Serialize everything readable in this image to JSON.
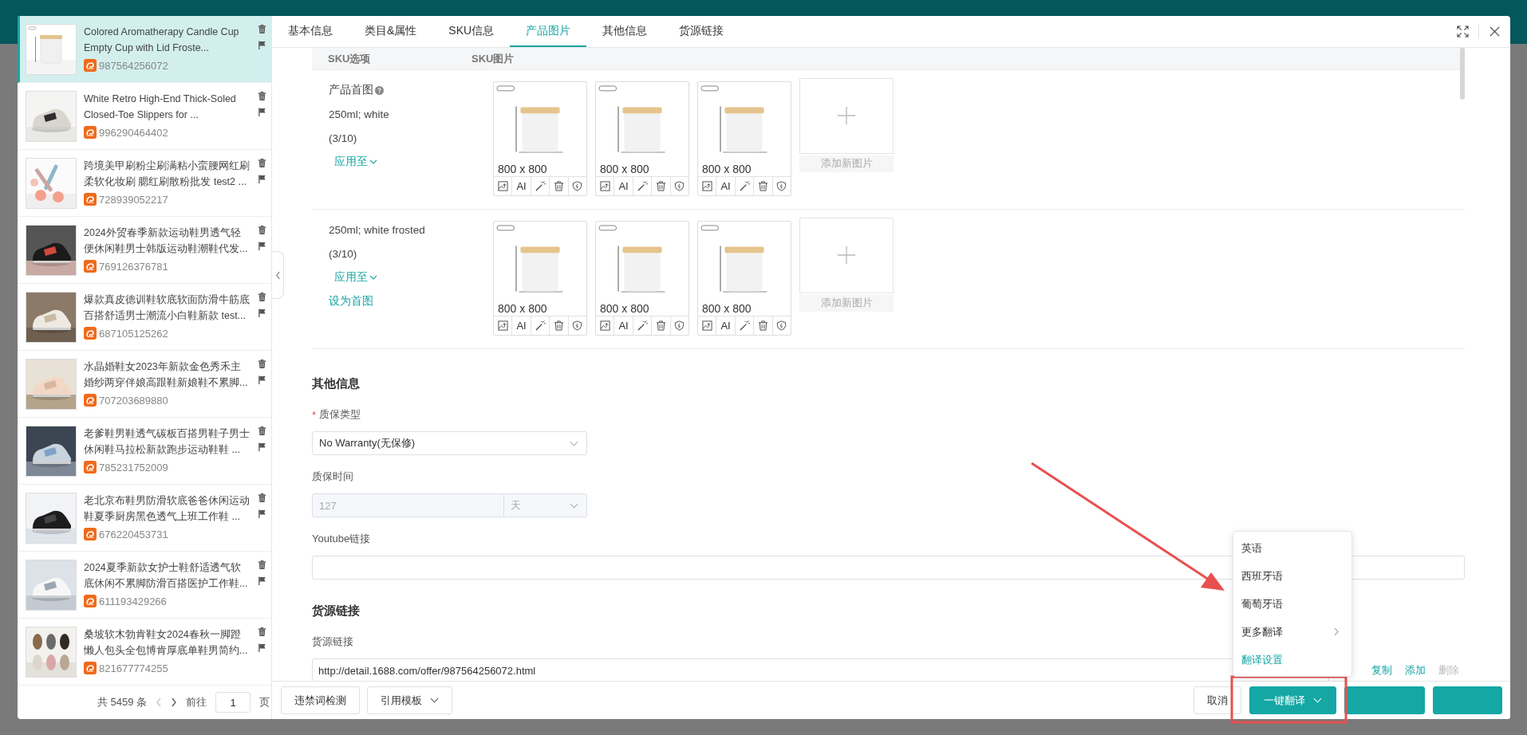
{
  "products": [
    {
      "title": "Colored Aromatherapy Candle Cup Empty Cup with Lid Froste...",
      "id": "987564256072",
      "selected": true
    },
    {
      "title": "White Retro High-End Thick-Soled Closed-Toe Slippers for ...",
      "id": "996290464402",
      "selected": false
    },
    {
      "title": "跨境美甲刷粉尘刷满粘小蛮腰网红刷柔软化妆刷 腮红刷散粉批发 test2 ...",
      "id": "728939052217",
      "selected": false
    },
    {
      "title": "2024外贸春季新款运动鞋男透气轻便休闲鞋男士韩版运动鞋潮鞋代发...",
      "id": "769126376781",
      "selected": false
    },
    {
      "title": "爆款真皮德训鞋软底软面防滑牛筋底百搭舒适男士潮流小白鞋新款 test...",
      "id": "687105125262",
      "selected": false
    },
    {
      "title": "水晶婚鞋女2023年新款金色秀禾主婚纱两穿伴娘高跟鞋新娘鞋不累脚...",
      "id": "707203689880",
      "selected": false
    },
    {
      "title": "老爹鞋男鞋透气碳板百搭男鞋子男士休闲鞋马拉松新款跑步运动鞋鞋 ...",
      "id": "785231752009",
      "selected": false
    },
    {
      "title": "老北京布鞋男防滑软底爸爸休闲运动鞋夏季厨房黑色透气上班工作鞋 ...",
      "id": "676220453731",
      "selected": false
    },
    {
      "title": "2024夏季新款女护士鞋舒适透气软底休闲不累脚防滑百搭医护工作鞋...",
      "id": "611193429266",
      "selected": false
    },
    {
      "title": "桑坡软木勃肯鞋女2024春秋一脚蹬懒人包头全包博肯厚底单鞋男简约...",
      "id": "821677774255",
      "selected": false
    }
  ],
  "pagination": {
    "total": "共 5459 条",
    "goto": "前往",
    "page": "1",
    "unit": "页"
  },
  "tabs": [
    {
      "label": "基本信息",
      "selected": false
    },
    {
      "label": "类目&属性",
      "selected": false
    },
    {
      "label": "SKU信息",
      "selected": false
    },
    {
      "label": "产品图片",
      "selected": true
    },
    {
      "label": "其他信息",
      "selected": false
    },
    {
      "label": "货源链接",
      "selected": false
    }
  ],
  "sku_table": {
    "columns": [
      "SKU选项",
      "SKU图片"
    ],
    "rows": [
      {
        "title": "产品首图",
        "variant": "250ml; white",
        "count": "(3/10)",
        "apply": "应用至",
        "images": [
          {
            "size": "800 x 800",
            "ai": "AI"
          },
          {
            "size": "800 x 800",
            "ai": "AI"
          },
          {
            "size": "800 x 800",
            "ai": "AI"
          }
        ],
        "add_label": "添加新图片"
      },
      {
        "variant": "250ml; white frosted",
        "count": "(3/10)",
        "apply": "应用至",
        "set_first": "设为首图",
        "images": [
          {
            "size": "800 x 800",
            "ai": "AI"
          },
          {
            "size": "800 x 800",
            "ai": "AI"
          },
          {
            "size": "800 x 800",
            "ai": "AI"
          }
        ],
        "add_label": "添加新图片"
      }
    ]
  },
  "other_info": {
    "title": "其他信息",
    "fields": [
      {
        "kind": "select",
        "label": "质保类型",
        "required_mark": "*",
        "value": "No Warranty(无保修)"
      },
      {
        "kind": "number_unit",
        "label": "质保时间",
        "value": "127",
        "unit": "天",
        "disabled": true
      },
      {
        "kind": "text",
        "label": "Youtube链接"
      }
    ]
  },
  "source": {
    "title": "货源链接",
    "label": "货源链接",
    "url": "http://detail.1688.com/offer/987564256072.html",
    "actions": [
      {
        "label": "复制",
        "disabled": false
      },
      {
        "label": "添加",
        "disabled": false
      },
      {
        "label": "删除",
        "disabled": true
      }
    ]
  },
  "footer": {
    "left": [
      {
        "label": "违禁词检测",
        "dropdown": false
      },
      {
        "label": "引用模板",
        "dropdown": true
      }
    ],
    "cancel": "取消",
    "translate": "一键翻译",
    "more_buttons": [
      {
        "kind": "primary"
      },
      {
        "kind": "primary"
      }
    ]
  },
  "translate_menu": [
    {
      "label": "英语",
      "kind": "item"
    },
    {
      "label": "西班牙语",
      "kind": "item"
    },
    {
      "label": "葡萄牙语",
      "kind": "item"
    },
    {
      "label": "更多翻译",
      "kind": "submenu"
    },
    {
      "label": "翻译设置",
      "kind": "link"
    }
  ],
  "annotations": {
    "arrow": true,
    "highlight_box": true
  }
}
